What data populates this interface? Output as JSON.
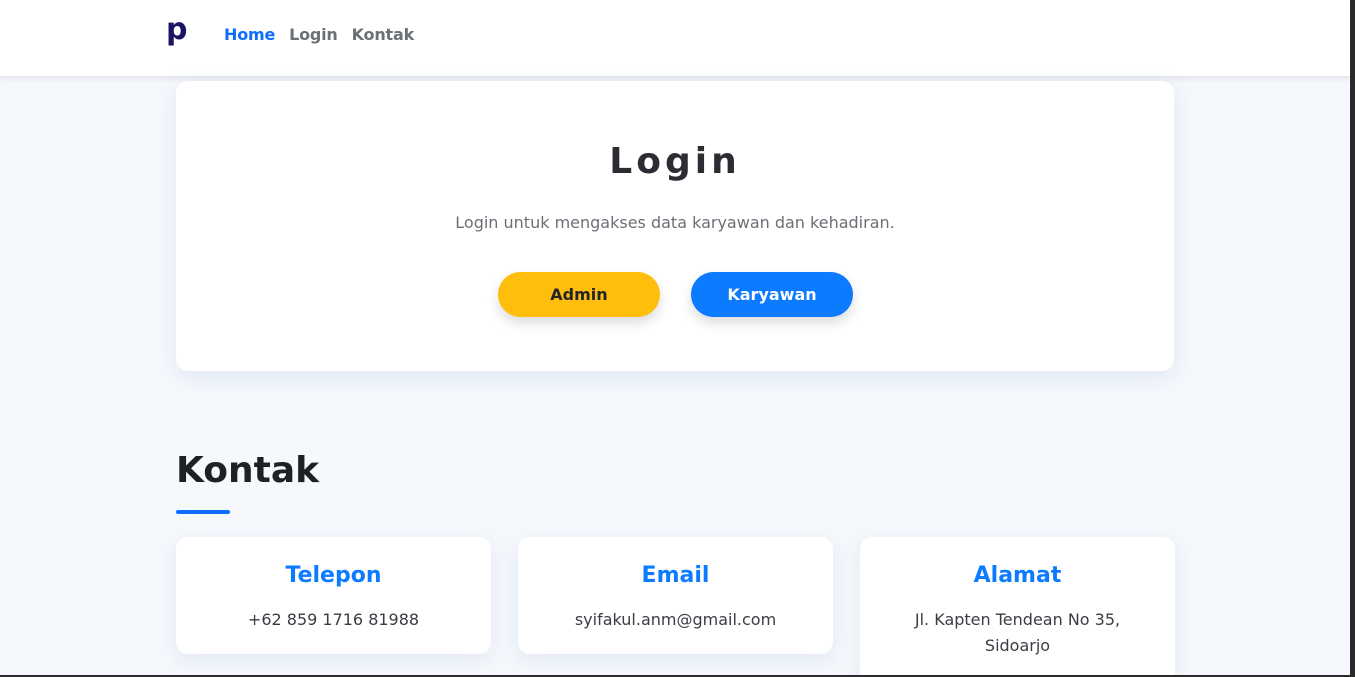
{
  "navbar": {
    "brand": "p",
    "links": [
      {
        "label": "Home",
        "active": true
      },
      {
        "label": "Login",
        "active": false
      },
      {
        "label": "Kontak",
        "active": false
      }
    ]
  },
  "login": {
    "title": "Login",
    "subtitle": "Login untuk mengakses data karyawan dan kehadiran.",
    "admin_label": "Admin",
    "karyawan_label": "Karyawan"
  },
  "kontak": {
    "title": "Kontak",
    "cards": [
      {
        "heading": "Telepon",
        "value": "+62 859 1716 81988"
      },
      {
        "heading": "Email",
        "value": "syifakul.anm@gmail.com"
      },
      {
        "heading": "Alamat",
        "value": "Jl. Kapten Tendean No 35, Sidoarjo"
      }
    ]
  },
  "colors": {
    "primary": "#0d6efd",
    "admin_button": "#ffbe0b",
    "karyawan_button": "#0d7bff",
    "brand": "#1b1464",
    "background": "#f5f8fc"
  }
}
